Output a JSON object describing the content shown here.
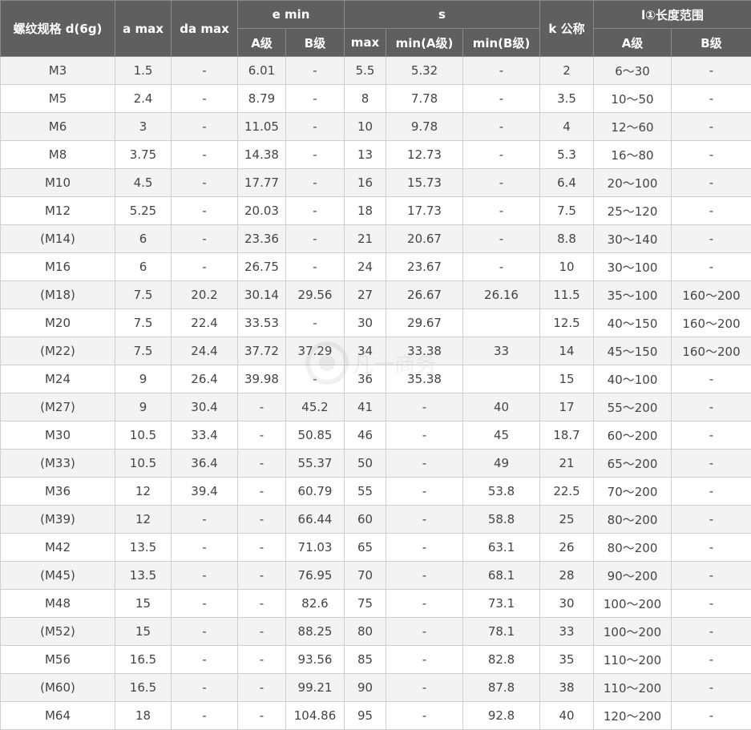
{
  "headers": {
    "thread": "螺纹规格 d(6g)",
    "a_max": "a max",
    "da_max": "da max",
    "e_min": "e min",
    "s": "s",
    "k": "k 公称",
    "l_range": "l①长度范围",
    "e_a": "A级",
    "e_b": "B级",
    "s_max": "max",
    "s_min_a": "min(A级)",
    "s_min_b": "min(B级)",
    "l_a": "A级",
    "l_b": "B级"
  },
  "rows": [
    [
      "M3",
      "1.5",
      "-",
      "6.01",
      "-",
      "5.5",
      "5.32",
      "-",
      "2",
      "6～30",
      "-"
    ],
    [
      "M5",
      "2.4",
      "-",
      "8.79",
      "-",
      "8",
      "7.78",
      "-",
      "3.5",
      "10～50",
      "-"
    ],
    [
      "M6",
      "3",
      "-",
      "11.05",
      "-",
      "10",
      "9.78",
      "-",
      "4",
      "12～60",
      "-"
    ],
    [
      "M8",
      "3.75",
      "-",
      "14.38",
      "-",
      "13",
      "12.73",
      "-",
      "5.3",
      "16～80",
      "-"
    ],
    [
      "M10",
      "4.5",
      "-",
      "17.77",
      "-",
      "16",
      "15.73",
      "-",
      "6.4",
      "20～100",
      "-"
    ],
    [
      "M12",
      "5.25",
      "-",
      "20.03",
      "-",
      "18",
      "17.73",
      "-",
      "7.5",
      "25～120",
      "-"
    ],
    [
      "(M14)",
      "6",
      "-",
      "23.36",
      "-",
      "21",
      "20.67",
      "-",
      "8.8",
      "30～140",
      "-"
    ],
    [
      "M16",
      "6",
      "-",
      "26.75",
      "-",
      "24",
      "23.67",
      "-",
      "10",
      "30～100",
      "-"
    ],
    [
      "(M18)",
      "7.5",
      "20.2",
      "30.14",
      "29.56",
      "27",
      "26.67",
      "26.16",
      "11.5",
      "35～100",
      "160～200"
    ],
    [
      "M20",
      "7.5",
      "22.4",
      "33.53",
      "-",
      "30",
      "29.67",
      "",
      "12.5",
      "40～150",
      "160～200"
    ],
    [
      "(M22)",
      "7.5",
      "24.4",
      "37.72",
      "37.29",
      "34",
      "33.38",
      "33",
      "14",
      "45～150",
      "160～200"
    ],
    [
      "M24",
      "9",
      "26.4",
      "39.98",
      "-",
      "36",
      "35.38",
      "",
      "15",
      "40～100",
      "-"
    ],
    [
      "(M27)",
      "9",
      "30.4",
      "-",
      "45.2",
      "41",
      "-",
      "40",
      "17",
      "55～200",
      "-"
    ],
    [
      "M30",
      "10.5",
      "33.4",
      "-",
      "50.85",
      "46",
      "-",
      "45",
      "18.7",
      "60～200",
      "-"
    ],
    [
      "(M33)",
      "10.5",
      "36.4",
      "-",
      "55.37",
      "50",
      "-",
      "49",
      "21",
      "65～200",
      "-"
    ],
    [
      "M36",
      "12",
      "39.4",
      "-",
      "60.79",
      "55",
      "-",
      "53.8",
      "22.5",
      "70～200",
      "-"
    ],
    [
      "(M39)",
      "12",
      "-",
      "-",
      "66.44",
      "60",
      "-",
      "58.8",
      "25",
      "80～200",
      "-"
    ],
    [
      "M42",
      "13.5",
      "-",
      "-",
      "71.03",
      "65",
      "-",
      "63.1",
      "26",
      "80～200",
      "-"
    ],
    [
      "(M45)",
      "13.5",
      "-",
      "-",
      "76.95",
      "70",
      "-",
      "68.1",
      "28",
      "90～200",
      "-"
    ],
    [
      "M48",
      "15",
      "-",
      "-",
      "82.6",
      "75",
      "-",
      "73.1",
      "30",
      "100～200",
      "-"
    ],
    [
      "(M52)",
      "15",
      "-",
      "-",
      "88.25",
      "80",
      "-",
      "78.1",
      "33",
      "100～200",
      "-"
    ],
    [
      "M56",
      "16.5",
      "-",
      "-",
      "93.56",
      "85",
      "-",
      "82.8",
      "35",
      "110～200",
      "-"
    ],
    [
      "(M60)",
      "16.5",
      "-",
      "-",
      "99.21",
      "90",
      "-",
      "87.8",
      "38",
      "110～200",
      "-"
    ],
    [
      "M64",
      "18",
      "-",
      "-",
      "104.86",
      "95",
      "-",
      "92.8",
      "40",
      "120～200",
      "-"
    ]
  ],
  "watermark_text": "凡一商务"
}
